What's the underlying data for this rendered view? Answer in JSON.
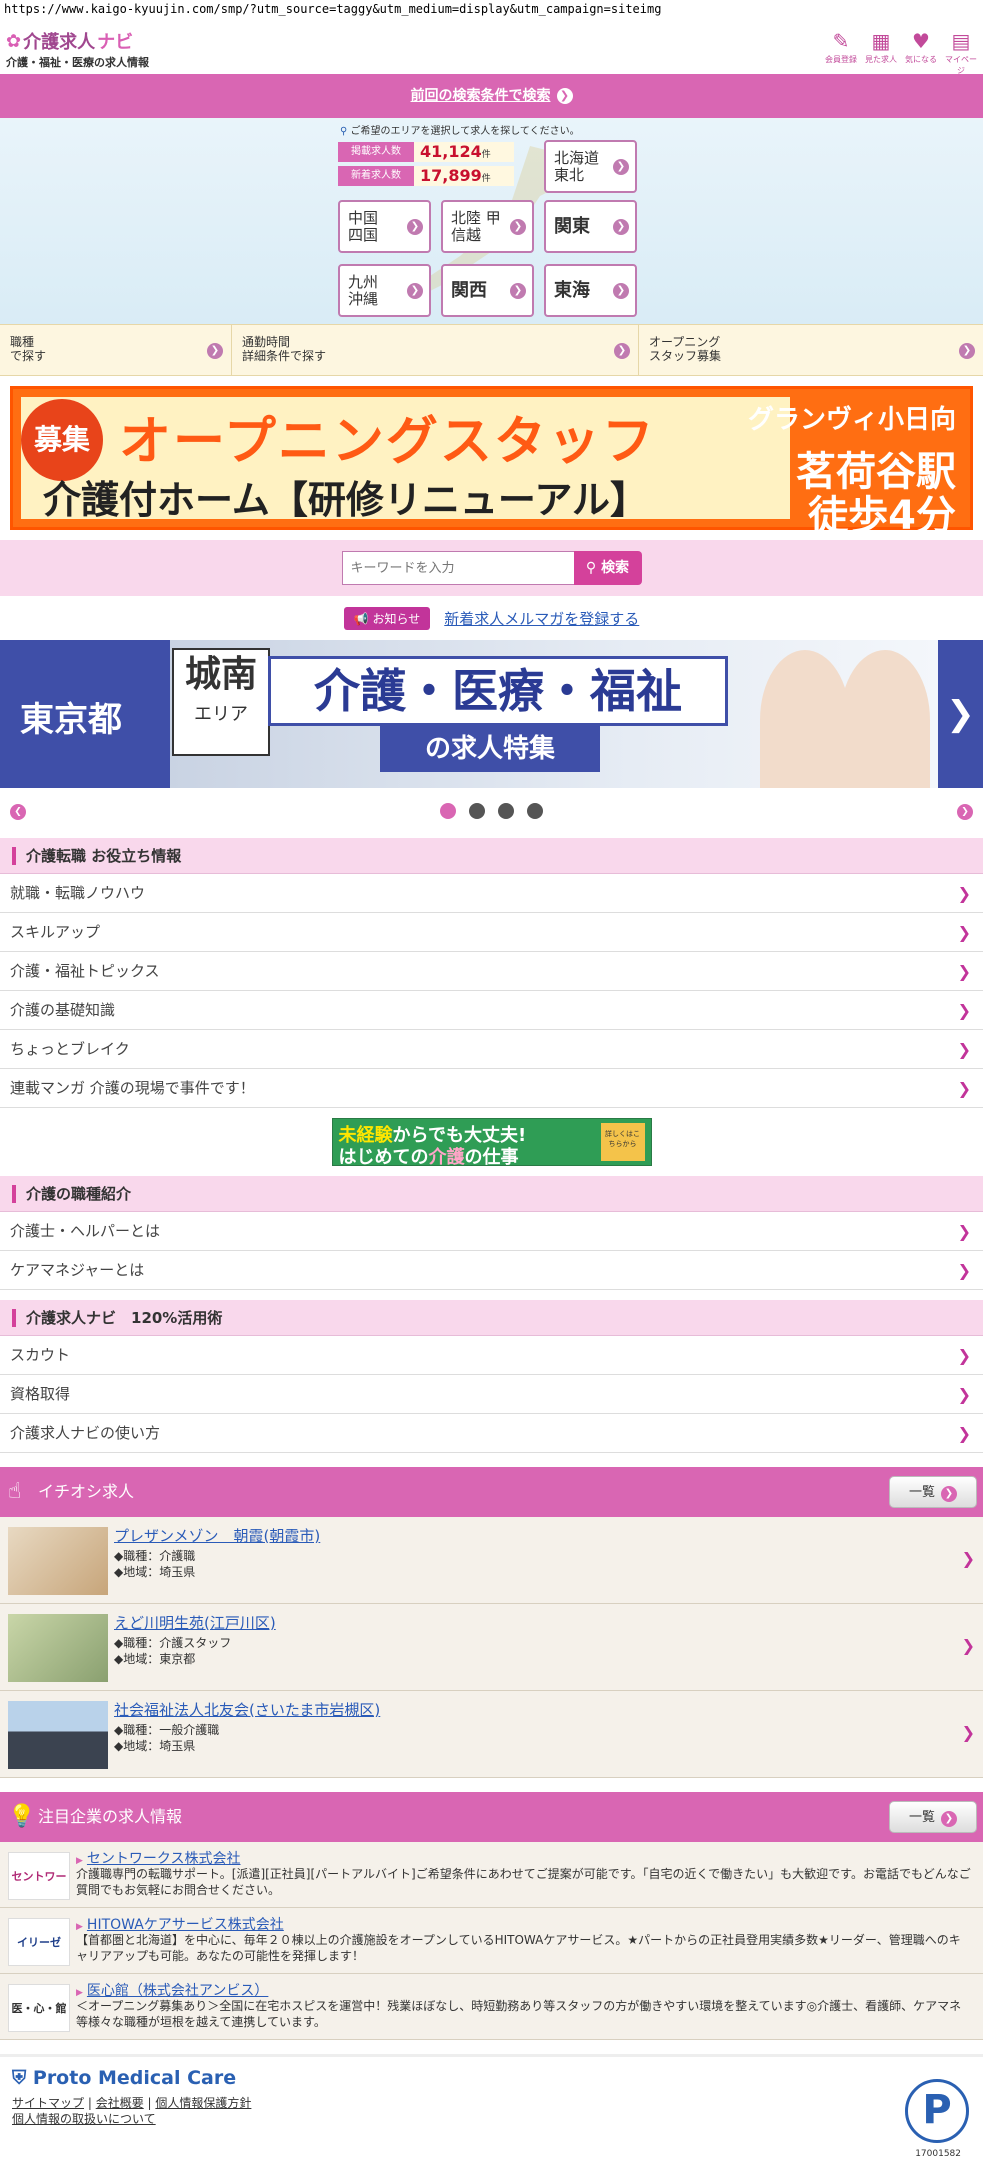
{
  "url": "https://www.kaigo-kyuujin.com/smp/?utm_source=taggy&utm_medium=display&utm_campaign=siteimg",
  "header": {
    "logo_main": "介護求人",
    "logo_accent": "ナビ",
    "logo_sub": "介護・福祉・医療の求人情報",
    "icons": [
      {
        "label": "会員登録",
        "icon": "pencil-icon"
      },
      {
        "label": "見た求人",
        "icon": "calendar-icon"
      },
      {
        "label": "気になる",
        "icon": "heart-icon"
      },
      {
        "label": "マイページ",
        "icon": "mypage-icon"
      }
    ]
  },
  "prev_search": "前回の検索条件で検索",
  "map": {
    "instruction": "ご希望のエリアを選択して求人を探してください。",
    "counts": [
      {
        "label": "掲載求人数",
        "value": "41,124",
        "unit": "件"
      },
      {
        "label": "新着求人数",
        "value": "17,899",
        "unit": "件"
      }
    ],
    "regions": [
      "北海道 東北",
      "中国 四国",
      "北陸 甲信越",
      "関東",
      "九州 沖縄",
      "関西",
      "東海"
    ]
  },
  "search_links": [
    {
      "line1": "職種",
      "line2": "で探す"
    },
    {
      "line1": "通勤時間",
      "line2": "詳細条件で探す"
    },
    {
      "line1": "オープニング",
      "line2": "スタッフ募集"
    }
  ],
  "banner1": {
    "badge": "募集",
    "title": "オープニングスタッフ",
    "subtitle": "介護付ホーム【研修リニューアル】",
    "right1": "グランヴィ小日向",
    "right2": "茗荷谷駅",
    "right3": "徒歩4分"
  },
  "keyword": {
    "placeholder": "キーワードを入力",
    "button": "検索"
  },
  "news": {
    "badge": "お知らせ",
    "link": "新着求人メルマガを登録する"
  },
  "banner2": {
    "region": "東京都",
    "area1": "城南",
    "area2": "エリア",
    "main": "介護・医療・福祉",
    "sub": "の求人特集"
  },
  "section1": {
    "title": "介護転職 お役立ち情報",
    "items": [
      "就職・転職ノウハウ",
      "スキルアップ",
      "介護・福祉トピックス",
      "介護の基礎知識",
      "ちょっとブレイク",
      "連載マンガ 介護の現場で事件です！"
    ]
  },
  "mini_banner": {
    "l1a": "未経験",
    "l1b": "からでも大丈夫!",
    "l2a": "はじめての",
    "l2b": "介護",
    "l2c": "の仕事",
    "box": "詳しくはこちらから"
  },
  "section2": {
    "title": "介護の職種紹介",
    "items": [
      "介護士・ヘルパーとは",
      "ケアマネジャーとは"
    ]
  },
  "section3": {
    "title": "介護求人ナビ　120%活用術",
    "items": [
      "スカウト",
      "資格取得",
      "介護求人ナビの使い方"
    ]
  },
  "pickup": {
    "title": "イチオシ求人",
    "all": "一覧",
    "jobs": [
      {
        "name": "プレザンメゾン　朝霞(朝霞市)",
        "type": "◆職種：介護職",
        "area": "◆地域：埼玉県"
      },
      {
        "name": "えど川明生苑(江戸川区)",
        "type": "◆職種：介護スタッフ",
        "area": "◆地域：東京都"
      },
      {
        "name": "社会福祉法人北友会(さいたま市岩槻区)",
        "type": "◆職種：一般介護職",
        "area": "◆地域：埼玉県"
      }
    ]
  },
  "companies": {
    "title": "注目企業の求人情報",
    "all": "一覧",
    "list": [
      {
        "logo": "セントワークス",
        "name": "セントワークス株式会社",
        "desc": "介護職専門の転職サポート。[派遣][正社員][パートアルバイト]ご希望条件にあわせてご提案が可能です。「自宅の近くで働きたい」も大歓迎です。お電話でもどんなご質問でもお気軽にお問合せください。"
      },
      {
        "logo": "イリーゼ",
        "name": "HITOWAケアサービス株式会社",
        "desc": "【首都圏と北海道】を中心に、毎年２０棟以上の介護施設をオープンしているHITOWAケアサービス。★パートからの正社員登用実績多数★リーダー、管理職へのキャリアアップも可能。あなたの可能性を発揮します！"
      },
      {
        "logo": "医・心・館",
        "name": "医心館（株式会社アンビス）",
        "desc": "＜オープニング募集あり＞全国に在宅ホスピスを運営中！残業ほぼなし、時短勤務あり等スタッフの方が働きやすい環境を整えています◎介護士、看護師、ケアマネ等様々な職種が垣根を越えて連携しています。"
      }
    ]
  },
  "footer": {
    "brand": "Proto Medical Care",
    "links": [
      "サイトマップ",
      "会社概要",
      "個人情報保護方針",
      "個人情報の取扱いについて"
    ],
    "privacy_no": "17001582"
  }
}
